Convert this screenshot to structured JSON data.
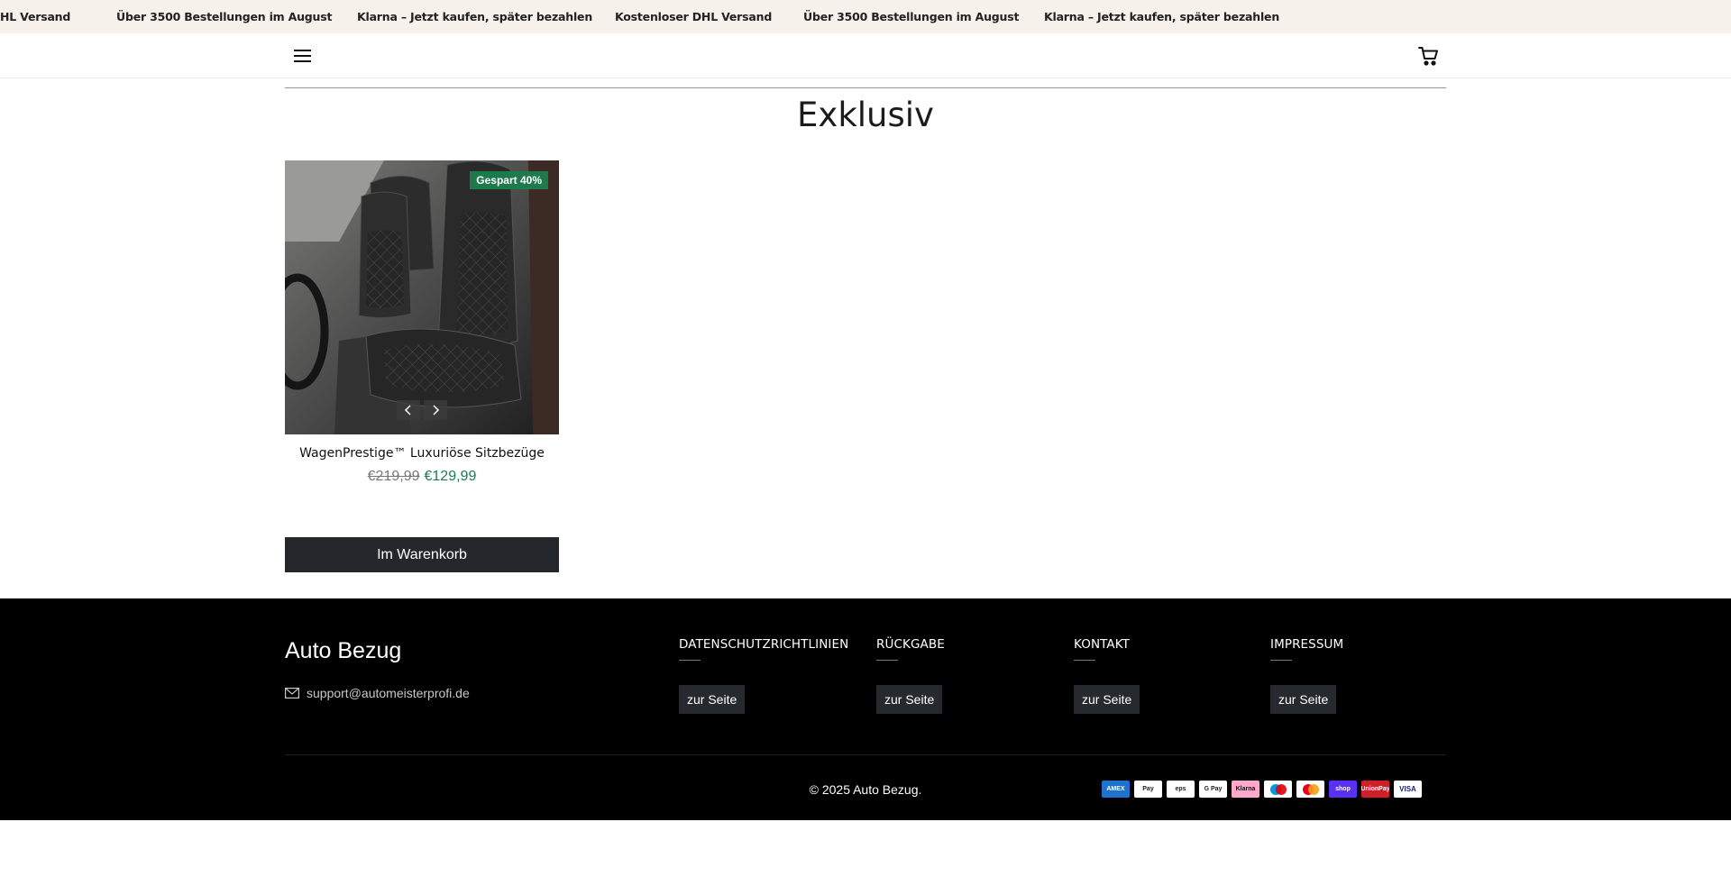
{
  "announcement": {
    "items": [
      "HL Versand",
      "Über 3500 Bestellungen im August",
      "Klarna – Jetzt kaufen, später bezahlen",
      "Kostenloser DHL Versand",
      "Über 3500 Bestellungen im August",
      "Klarna – Jetzt kaufen, später bezahlen"
    ]
  },
  "header": {
    "menu_icon": "hamburger-menu-icon",
    "cart_icon": "shopping-cart-icon"
  },
  "page": {
    "title": "Exklusiv"
  },
  "product": {
    "badge": "Gespart 40%",
    "title": "WagenPrestige™ Luxuriöse Sitzbezüge",
    "price_old": "€219,99",
    "price_new": "€129,99",
    "add_to_cart_label": "Im Warenkorb",
    "image_icon": "car-seat-cover-photo",
    "accent_color": "#1e7a4c"
  },
  "footer": {
    "brand": "Auto Bezug",
    "email": "support@automeisterprofi.de",
    "columns": [
      {
        "heading": "DATENSCHUTZRICHTLINIEN",
        "button": "zur Seite"
      },
      {
        "heading": "RÜCKGABE",
        "button": "zur Seite"
      },
      {
        "heading": "KONTAKT",
        "button": "zur Seite"
      },
      {
        "heading": "IMPRESSUM",
        "button": "zur Seite"
      }
    ],
    "copyright": "© 2025 Auto Bezug.",
    "payments": [
      {
        "name": "amex-icon",
        "label": "AMEX",
        "color": "#1f72cd"
      },
      {
        "name": "apple-pay-icon",
        "label": "Pay",
        "color": "#ffffff"
      },
      {
        "name": "eps-icon",
        "label": "eps",
        "color": "#ffffff"
      },
      {
        "name": "google-pay-icon",
        "label": "G Pay",
        "color": "#ffffff"
      },
      {
        "name": "klarna-icon",
        "label": "Klarna",
        "color": "#ffa8cd"
      },
      {
        "name": "maestro-icon",
        "label": "",
        "color": "#ffffff"
      },
      {
        "name": "mastercard-icon",
        "label": "",
        "color": "#ffffff"
      },
      {
        "name": "shop-pay-icon",
        "label": "shop",
        "color": "#5a31f4"
      },
      {
        "name": "unionpay-icon",
        "label": "UnionPay",
        "color": "#d11f2a"
      },
      {
        "name": "visa-icon",
        "label": "VISA",
        "color": "#ffffff"
      }
    ]
  }
}
